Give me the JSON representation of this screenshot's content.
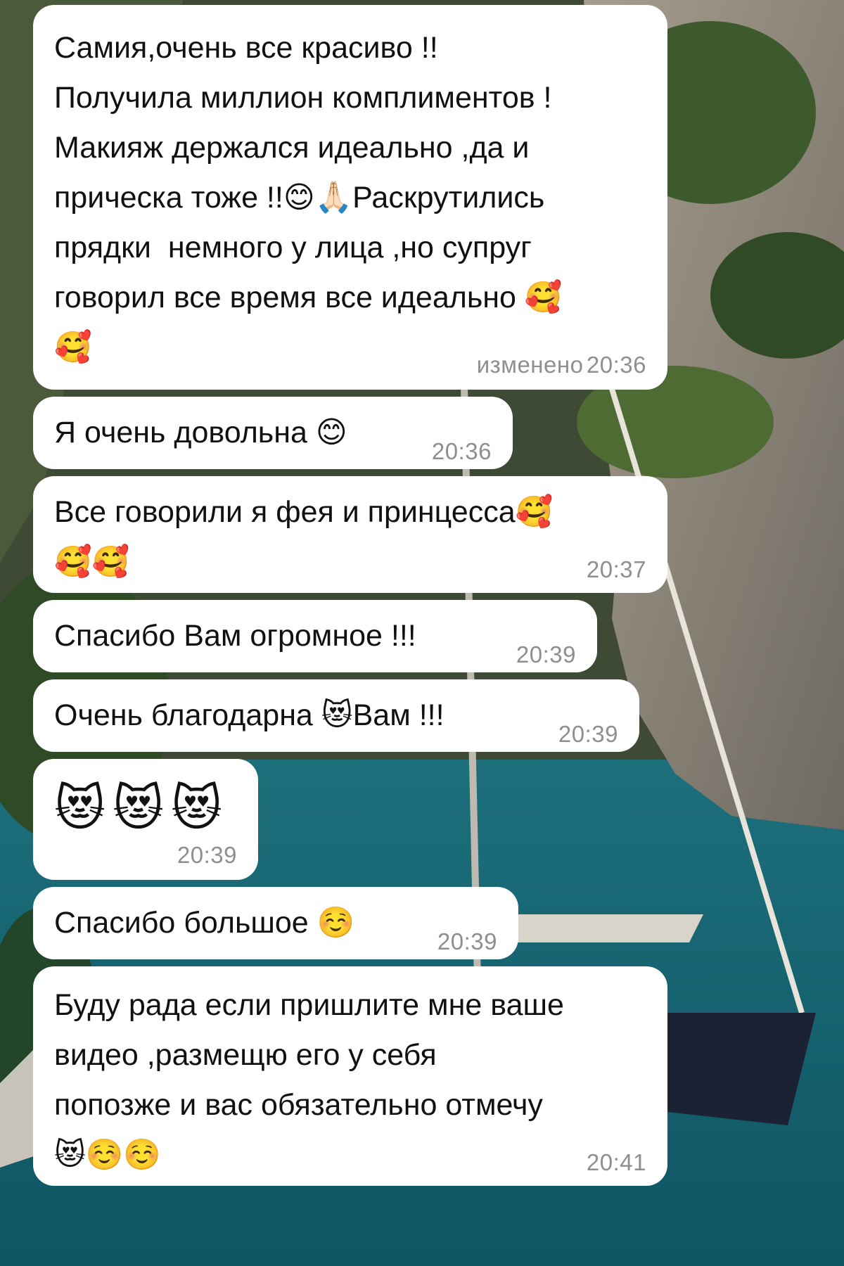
{
  "messages": [
    {
      "text": "Самия,очень все красиво !!\nПолучила миллион комплиментов !\nМакияж держался идеально ,да и\nприческа тоже !!😊🙏🏻Раскрутились\nпрядки  немного у лица ,но супруг\nговорил все время все идеально 🥰\n🥰",
      "edited_label": "изменено",
      "time": "20:36"
    },
    {
      "text": "Я очень довольна 😊",
      "time": "20:36"
    },
    {
      "text": "Все говорили я фея и принцесса🥰\n🥰🥰",
      "time": "20:37"
    },
    {
      "text": "Спасибо Вам огромное !!!",
      "time": "20:39"
    },
    {
      "text": "Очень благодарна 😻Вам !!!",
      "time": "20:39"
    },
    {
      "text": "😻😻😻",
      "time": "20:39"
    },
    {
      "text": "Спасибо большое ☺️",
      "time": "20:39"
    },
    {
      "text": "Буду рада если пришлите мне ваше\nвидео ,размещю его у себя\nпопозже и вас обязательно отмечу\n😻☺️☺️",
      "time": "20:41"
    }
  ]
}
